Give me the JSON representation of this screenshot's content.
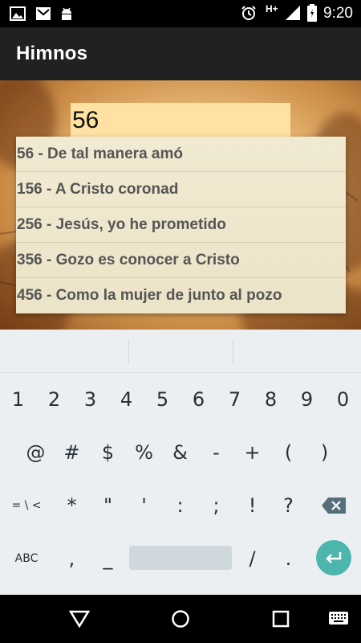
{
  "status_bar": {
    "network": "H+",
    "time": "9:20"
  },
  "app_bar": {
    "title": "Himnos"
  },
  "search": {
    "value": "56"
  },
  "suggestions": [
    {
      "label": "56 - De tal manera amó"
    },
    {
      "label": "156 - A Cristo coronad"
    },
    {
      "label": "256 - Jesús, yo he prometido"
    },
    {
      "label": "356 - Gozo es conocer a Cristo"
    },
    {
      "label": "456 - Como la mujer de junto al pozo"
    }
  ],
  "keyboard": {
    "row1": [
      "1",
      "2",
      "3",
      "4",
      "5",
      "6",
      "7",
      "8",
      "9",
      "0"
    ],
    "row2": [
      "@",
      "#",
      "$",
      "%",
      "&",
      "-",
      "+",
      "(",
      ")"
    ],
    "row3": [
      "= \\ <",
      "*",
      "\"",
      "'",
      ":",
      ";",
      "!",
      "?"
    ],
    "abc_label": "ABC",
    "comma": ",",
    "underscore": "_",
    "slash": "/",
    "period": "."
  },
  "colors": {
    "app_bar": "#212121",
    "search_field": "#ffe2a3",
    "enter_key": "#4db6ac",
    "keyboard_bg": "#eceff1"
  }
}
